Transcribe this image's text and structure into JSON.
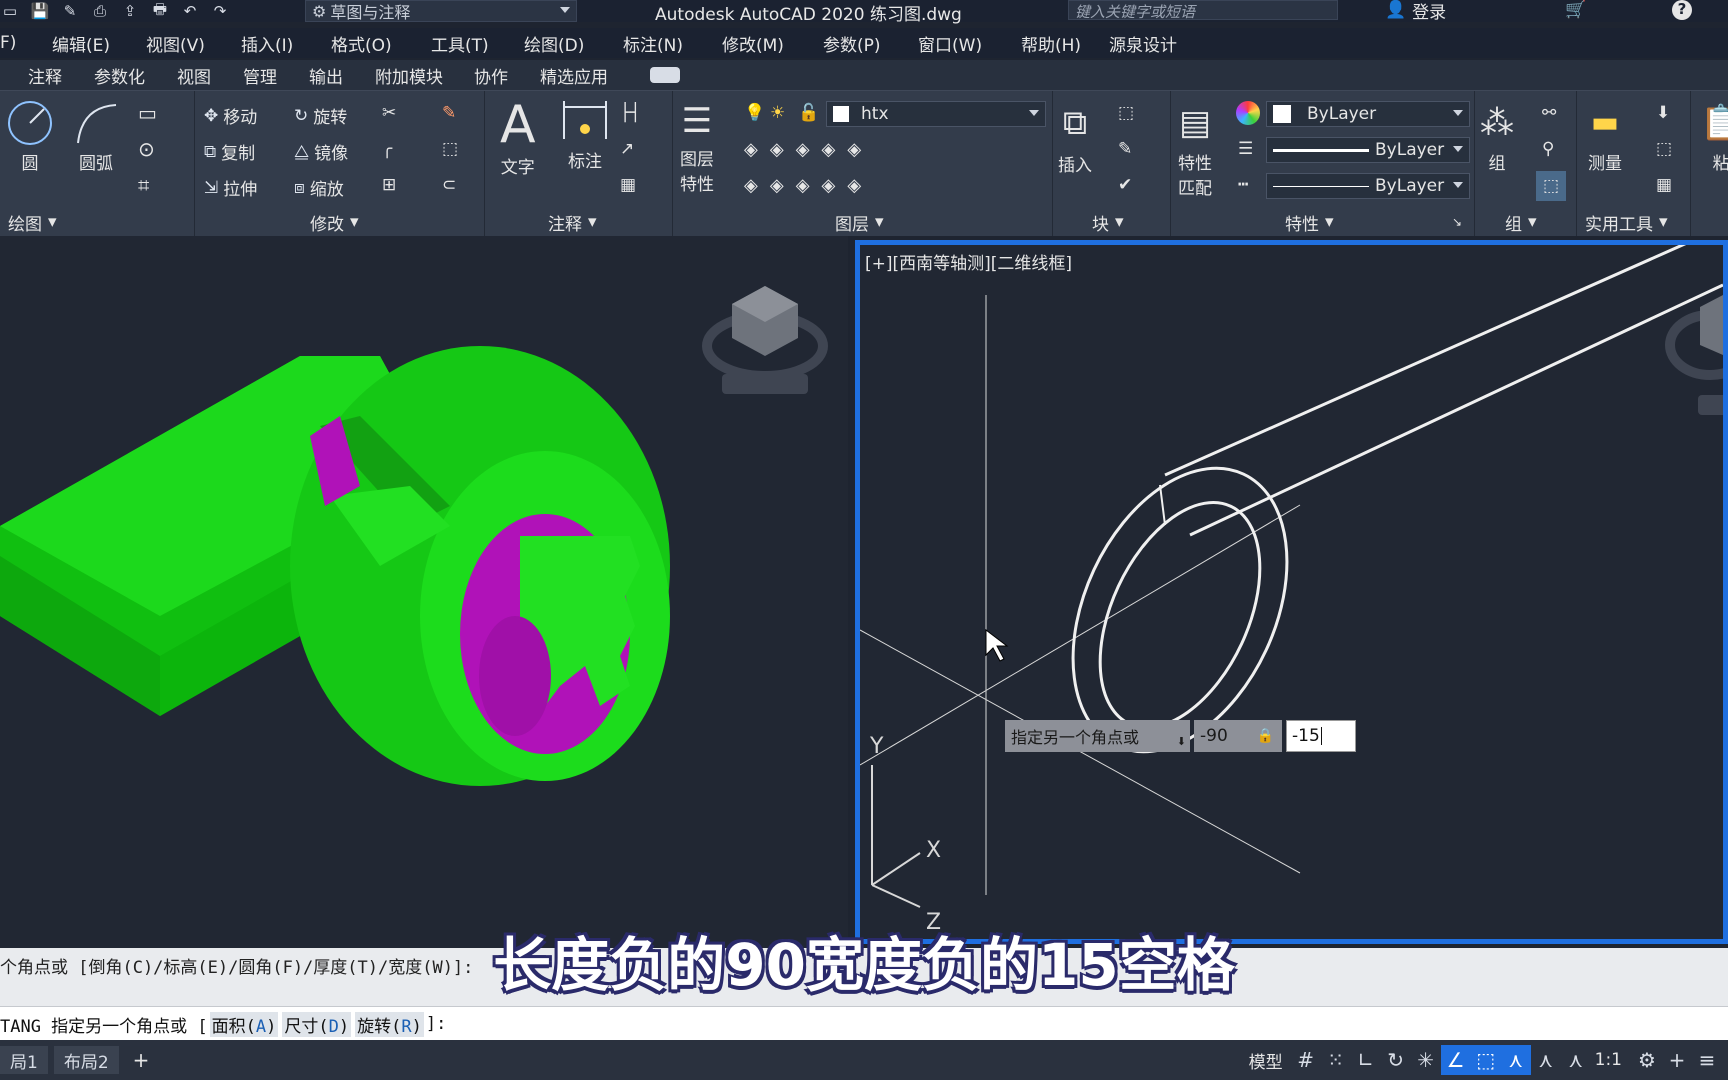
{
  "titlebar": {
    "workspace": "草图与注释",
    "app_title": "Autodesk AutoCAD 2020    练习图.dwg",
    "search_placeholder": "键入关键字或短语",
    "login": "登录"
  },
  "menu": [
    "F)",
    "编辑(E)",
    "视图(V)",
    "插入(I)",
    "格式(O)",
    "工具(T)",
    "绘图(D)",
    "标注(N)",
    "修改(M)",
    "参数(P)",
    "窗口(W)",
    "帮助(H)",
    "源泉设计"
  ],
  "ribbon_tabs": [
    "注释",
    "参数化",
    "视图",
    "管理",
    "输出",
    "附加模块",
    "协作",
    "精选应用"
  ],
  "ribbon": {
    "draw": {
      "circle": "圆",
      "arc": "圆弧",
      "footer": "绘图"
    },
    "modify": {
      "move": "移动",
      "rotate": "旋转",
      "copy": "复制",
      "mirror": "镜像",
      "stretch": "拉伸",
      "scale": "缩放",
      "footer": "修改"
    },
    "annotation": {
      "text": "文字",
      "dimension": "标注",
      "footer": "注释"
    },
    "layers": {
      "props_line1": "图层",
      "props_line2": "特性",
      "current_layer": "htx",
      "footer": "图层"
    },
    "block": {
      "insert": "插入",
      "footer": "块"
    },
    "properties": {
      "match_line1": "特性",
      "match_line2": "匹配",
      "color": "ByLayer",
      "linetype": "ByLayer",
      "lineweight": "ByLayer",
      "footer": "特性"
    },
    "group": {
      "group": "组",
      "footer": "组"
    },
    "utilities": {
      "measure": "测量",
      "footer": "实用工具"
    },
    "clipboard": {
      "paste": "粘"
    }
  },
  "viewport": {
    "label": "[+][西南等轴测][二维线框]",
    "axis_x": "X",
    "axis_y": "Y",
    "axis_z": "Z"
  },
  "dynamic_input": {
    "prompt": "指定另一个角点或",
    "value1": "-90",
    "value2": "-15"
  },
  "command": {
    "history": "个角点或 [倒角(C)/标高(E)/圆角(F)/厚度(T)/宽度(W)]:",
    "prefix": "TANG 指定另一个角点或 [",
    "opt1_label": "面积(",
    "opt1_key": "A",
    "opt2_label": "尺寸(",
    "opt2_key": "D",
    "opt3_label": "旋转(",
    "opt3_key": "R",
    "suffix": "]:"
  },
  "status": {
    "layout1": "局1",
    "layout2": "布局2",
    "plus": "+",
    "model": "模型",
    "scale": "1:1"
  },
  "subtitle": "长度负的90宽度负的15空格",
  "colors": {
    "accent": "#1f6fe0",
    "solid_green": "#19d119",
    "solid_magenta": "#b012b8"
  }
}
